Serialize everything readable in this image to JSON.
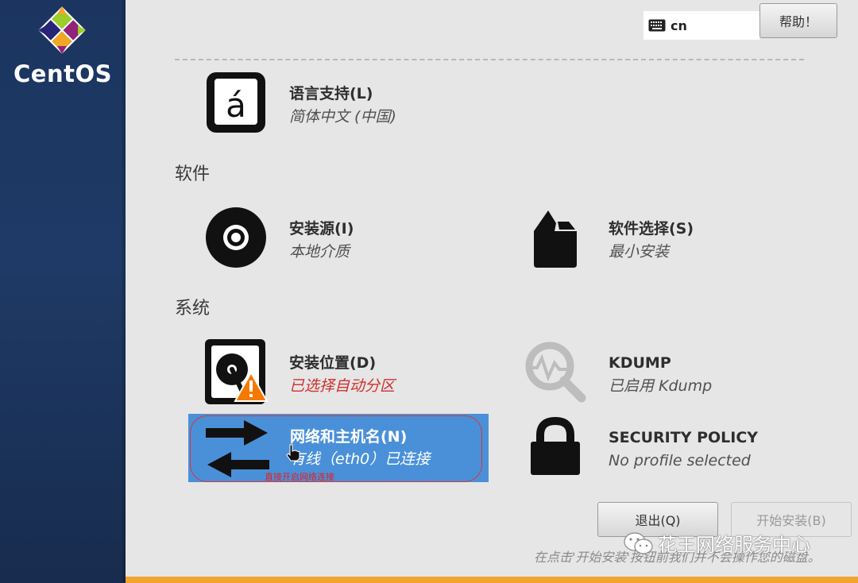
{
  "brand": {
    "name": "CentOS"
  },
  "header": {
    "keyboard_layout": "cn",
    "help_label": "帮助！"
  },
  "localization": {
    "language": {
      "title": "语言支持(L)",
      "status": "简体中文 (中国)"
    }
  },
  "software": {
    "heading": "软件",
    "source": {
      "title": "安装源(I)",
      "status": "本地介质"
    },
    "selection": {
      "title": "软件选择(S)",
      "status": "最小安装"
    }
  },
  "system": {
    "heading": "系统",
    "destination": {
      "title": "安装位置(D)",
      "status": "已选择自动分区"
    },
    "kdump": {
      "title": "KDUMP",
      "status": "已启用 Kdump"
    },
    "network": {
      "title": "网络和主机名(N)",
      "status": "有线（eth0）已连接",
      "annotation": "直接开启网络连接"
    },
    "security": {
      "title": "SECURITY POLICY",
      "status": "No profile selected"
    }
  },
  "footer": {
    "quit_label": "退出(Q)",
    "begin_label": "开始安装(B)",
    "note": "在点击'开始安装'按钮前我们并不会操作您的磁盘。"
  },
  "watermark": {
    "text": "花王网络服务中心"
  },
  "colors": {
    "sidebar": "#1f3a66",
    "selected": "#4a90d9",
    "warning": "#d0312d",
    "accent_bar": "#f0a52c"
  }
}
